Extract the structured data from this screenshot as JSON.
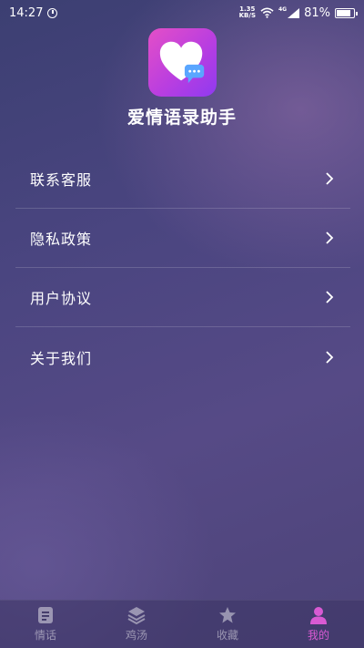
{
  "status_bar": {
    "time": "14:27",
    "net_speed_value": "1.35",
    "net_speed_unit": "KB/S",
    "network_type": "4G",
    "battery_percent": "81%",
    "battery_level": 0.81,
    "icons": [
      "alarm-icon",
      "wifi-icon",
      "signal-icon",
      "battery-icon"
    ]
  },
  "header": {
    "app_name": "爱情语录助手",
    "logo_icon": "heart-chat-icon"
  },
  "menu": {
    "items": [
      {
        "label": "联系客服",
        "icon": "chevron-right-icon"
      },
      {
        "label": "隐私政策",
        "icon": "chevron-right-icon"
      },
      {
        "label": "用户协议",
        "icon": "chevron-right-icon"
      },
      {
        "label": "关于我们",
        "icon": "chevron-right-icon"
      }
    ]
  },
  "tabs": [
    {
      "label": "情话",
      "icon": "document-icon",
      "active": false
    },
    {
      "label": "鸡汤",
      "icon": "layers-icon",
      "active": false
    },
    {
      "label": "收藏",
      "icon": "star-icon",
      "active": false
    },
    {
      "label": "我的",
      "icon": "person-icon",
      "active": true
    }
  ],
  "colors": {
    "active_tab": "#d95ad3",
    "inactive_tab": "rgba(255,255,255,0.45)",
    "logo_gradient_start": "#e44fc7",
    "logo_gradient_end": "#8f3af0"
  }
}
